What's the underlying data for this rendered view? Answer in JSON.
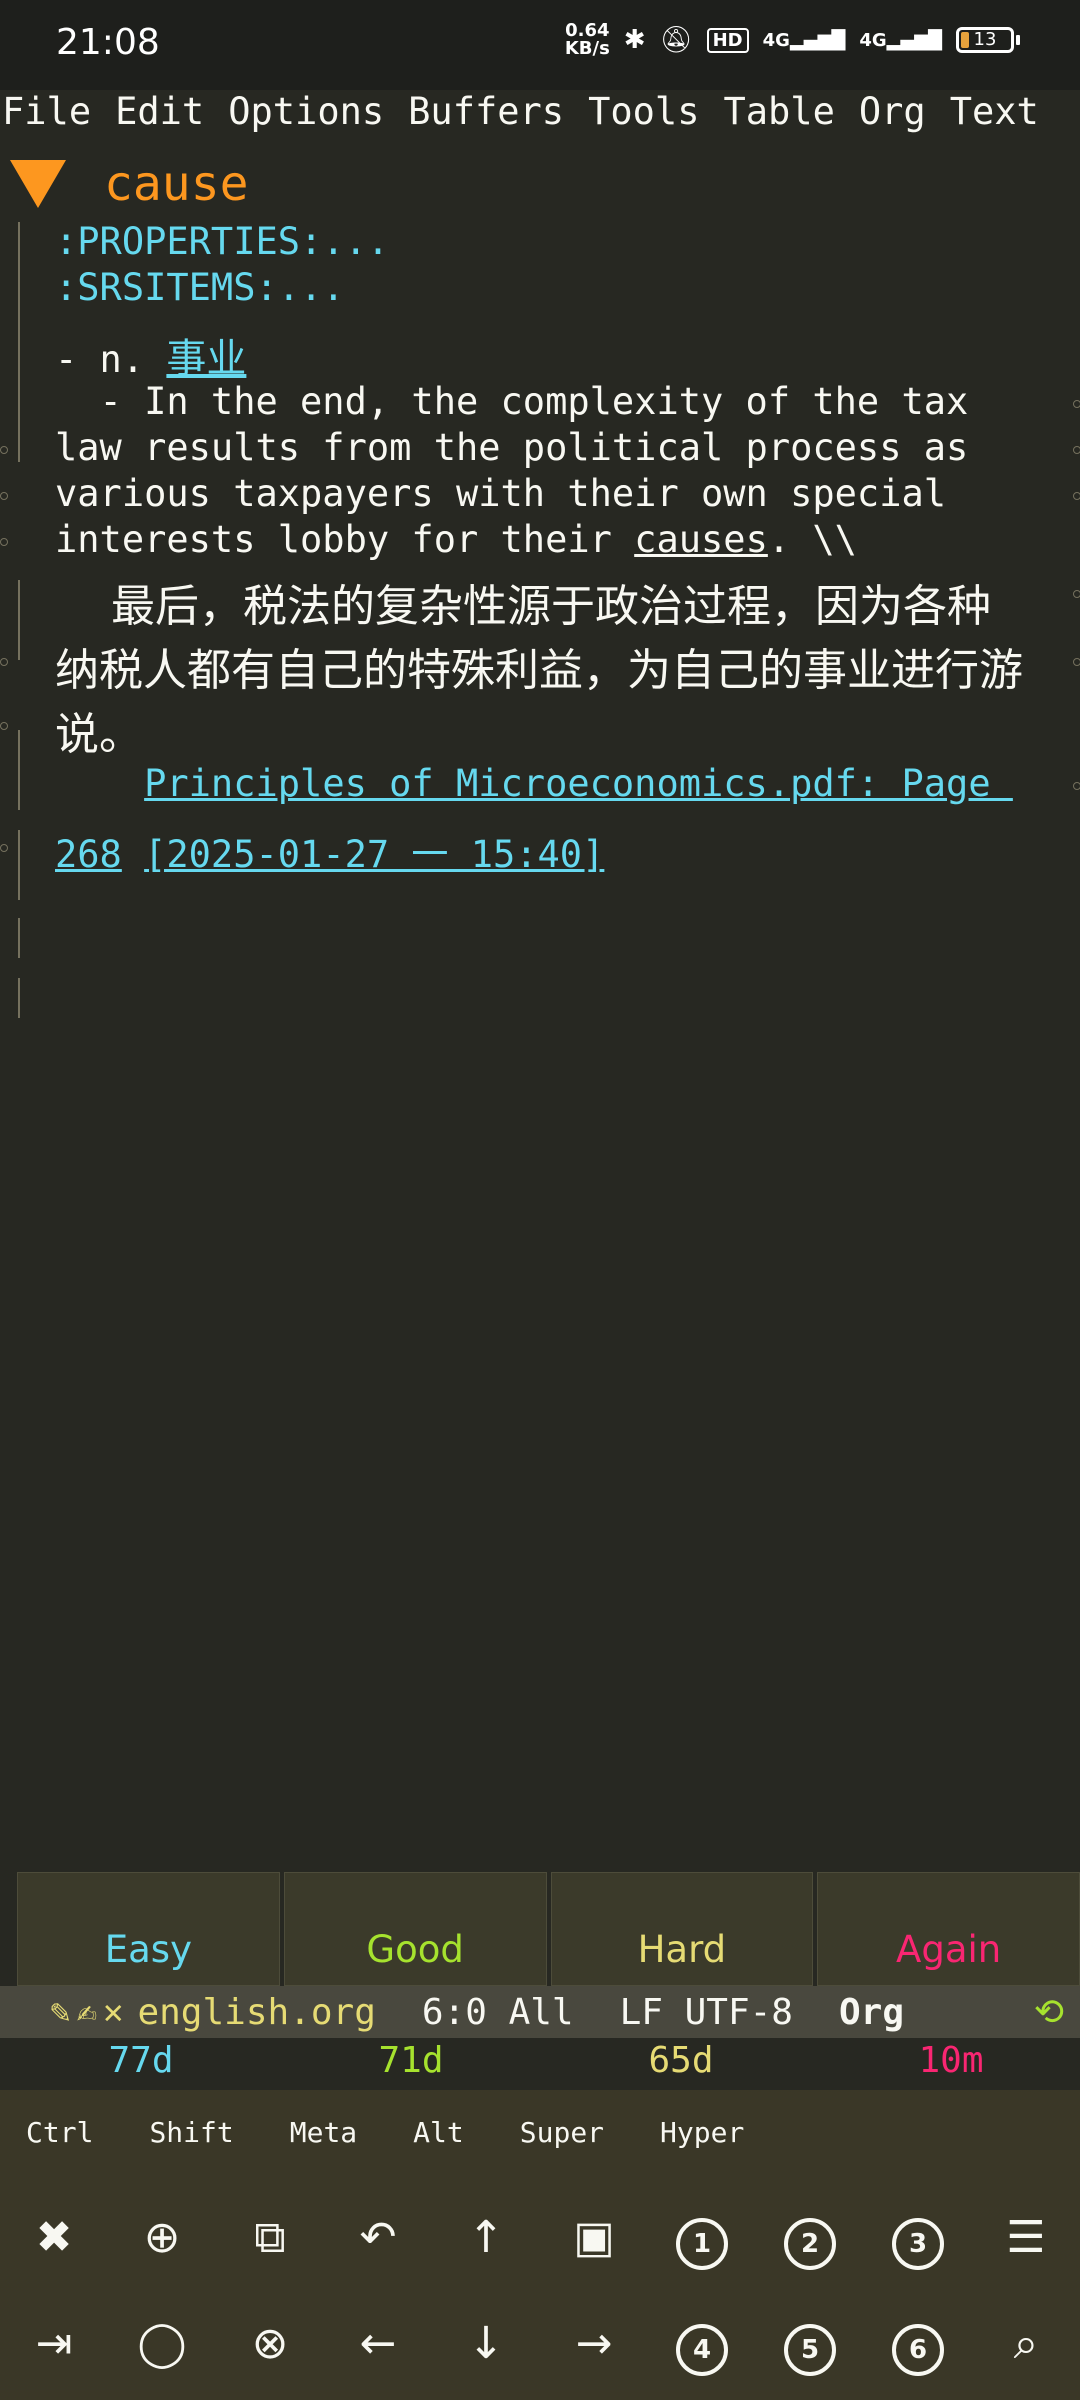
{
  "status_bar": {
    "time": "21:08",
    "net_speed_value": "0.64",
    "net_speed_unit": "KB/s",
    "hd_label": "HD",
    "signal1": "4G",
    "signal2": "4G",
    "battery": "13"
  },
  "menu": [
    "File",
    "Edit",
    "Options",
    "Buffers",
    "Tools",
    "Table",
    "Org",
    "Text"
  ],
  "editor": {
    "heading": "cause",
    "properties": ":PROPERTIES:...",
    "srsitems": ":SRSITEMS:...",
    "def_prefix": "- n. ",
    "def_link": "事业",
    "example_lines": [
      "  - In the end, the complexity of the tax",
      "law results from the political process as",
      "various taxpayers with their own special"
    ],
    "example_last_prefix": "interests lobby for their ",
    "example_last_underline": "causes",
    "example_last_suffix": ". \\\\",
    "translation_lines": [
      "    最后，税法的复杂性源于政治过程，因为各种",
      "纳税人都有自己的特殊利益，为自己的事业进行游",
      "说。"
    ],
    "source_link_1": "Principles of Microeconomics.pdf: Page ",
    "source_link_2": "268",
    "timestamp": "[2025-01-27 一 15:40]"
  },
  "srs_buttons": [
    {
      "label": "Easy",
      "color": "#66d9ef"
    },
    {
      "label": "Good",
      "color": "#a6e22e"
    },
    {
      "label": "Hard",
      "color": "#e6db74"
    },
    {
      "label": "Again",
      "color": "#f92672"
    }
  ],
  "mode_line": {
    "filename": "english.org",
    "position": "6:0 All",
    "encoding": "LF UTF-8",
    "major_mode": "Org"
  },
  "intervals": [
    {
      "value": "77d",
      "color": "#66d9ef"
    },
    {
      "value": "71d",
      "color": "#a6e22e"
    },
    {
      "value": "65d",
      "color": "#e6db74"
    },
    {
      "value": "10m",
      "color": "#f92672"
    }
  ],
  "modifier_keys": [
    "Ctrl",
    "Shift",
    "Meta",
    "Alt",
    "Super",
    "Hyper"
  ],
  "key_row1": [
    "close-icon",
    "add-circle-icon",
    "copy-icon",
    "undo-icon",
    "arrow-up-icon",
    "save-icon",
    "1",
    "2",
    "3",
    "menu-icon"
  ],
  "key_row2": [
    "tab-icon",
    "circle-icon",
    "cancel-circle-icon",
    "arrow-left-icon",
    "arrow-down-icon",
    "arrow-right-icon",
    "4",
    "5",
    "6",
    "search-icon"
  ],
  "colors": {
    "background": "#272822",
    "heading": "#fd971f",
    "link": "#66d9ef"
  }
}
